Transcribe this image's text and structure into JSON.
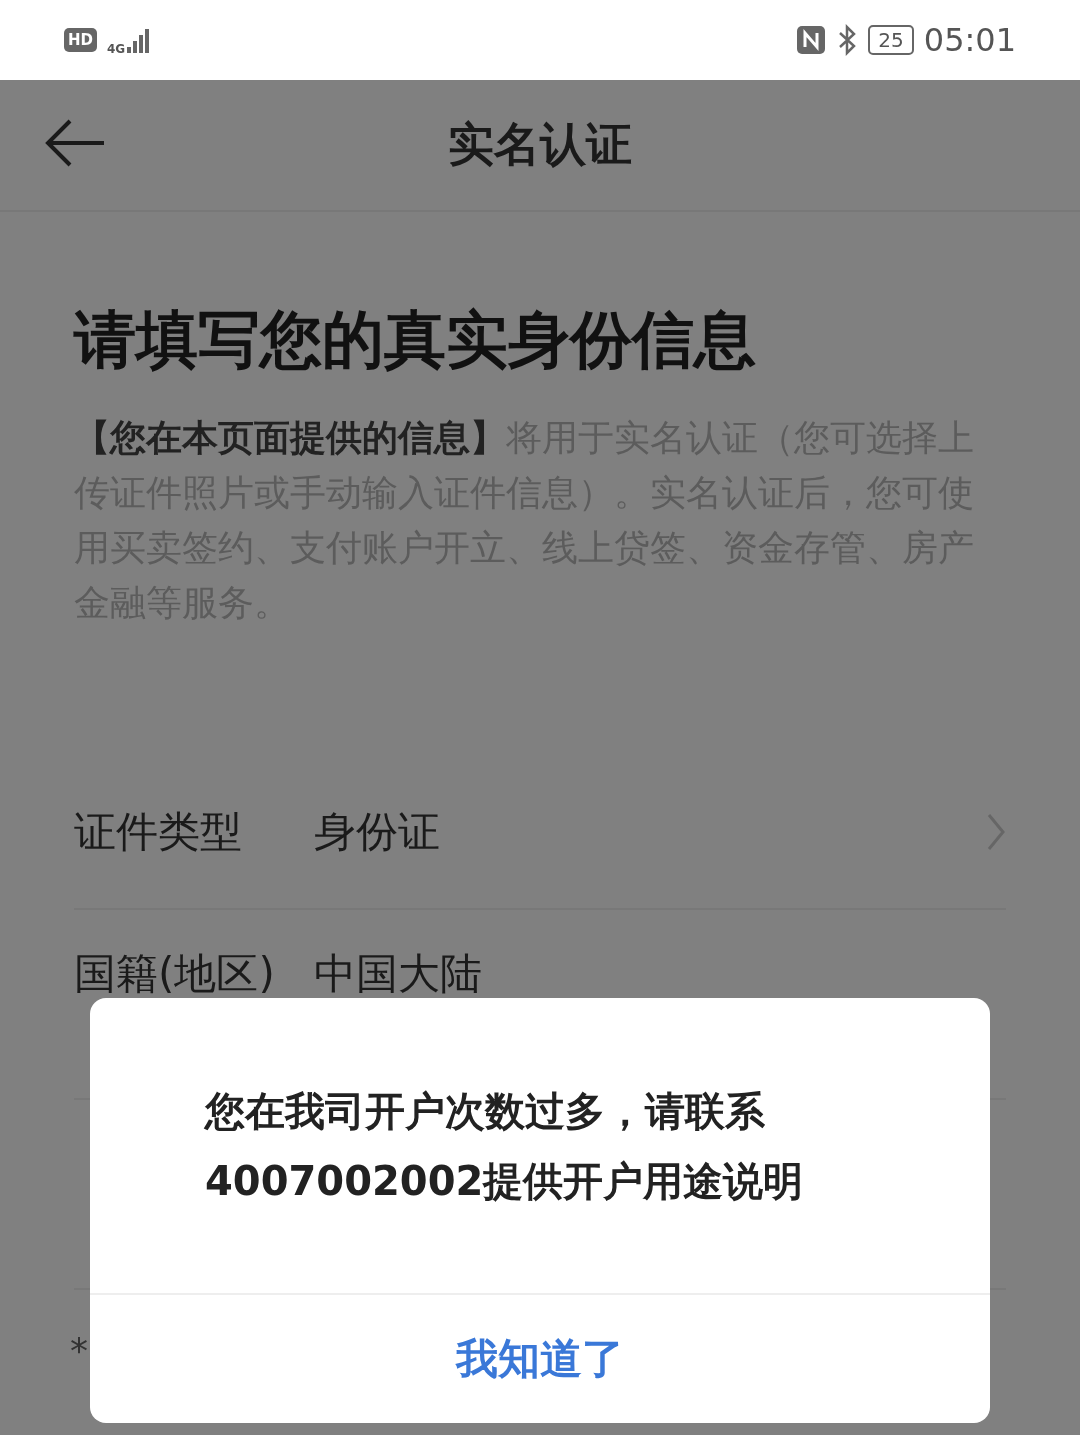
{
  "status_bar": {
    "left_badge": "HD",
    "network": "4G",
    "battery": "25",
    "time": "05:01"
  },
  "nav": {
    "title": "实名认证"
  },
  "heading": "请填写您的真实身份信息",
  "description": "**【您在本页面提供的信息】**将用于实名认证（您可选择上传证件照片或手动输入证件信息）。实名认证后，您可使用买卖签约、支付账户开立、线上贷签、资金存管、房产金融等服务。",
  "fields": [
    {
      "label": "证件类型",
      "value": "身份证",
      "has_chevron": true
    },
    {
      "label": "国籍(地区)",
      "value": "中国大陆",
      "has_chevron": false
    }
  ],
  "footnote_mark": "*",
  "dialog": {
    "message": "您在我司开户次数过多，请联系4007002002提供开户用途说明",
    "button": "我知道了"
  }
}
